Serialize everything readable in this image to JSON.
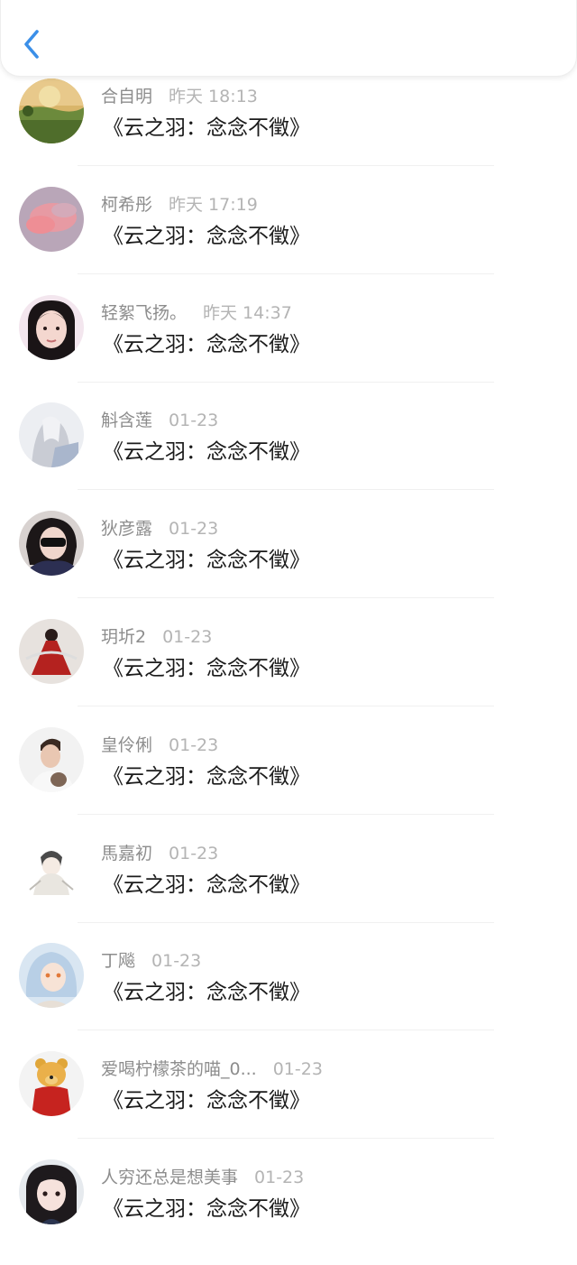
{
  "header": {
    "back_icon": "chevron-left-icon",
    "accent": "#3b8fe8"
  },
  "messages": [
    {
      "name": "合自明",
      "time": "昨天 18:13",
      "text": "《云之羽：念念不徵》",
      "avatar": "landscape-sunset"
    },
    {
      "name": "柯希彤",
      "time": "昨天 17:19",
      "text": "《云之羽：念念不徵》",
      "avatar": "pink-cloud"
    },
    {
      "name": "轻絮飞扬。",
      "time": "昨天 14:37",
      "text": "《云之羽：念念不徵》",
      "avatar": "girl-portrait"
    },
    {
      "name": "斛含莲",
      "time": "01-23",
      "text": "《云之羽：念念不徵》",
      "avatar": "anime-girl-white"
    },
    {
      "name": "狄彦露",
      "time": "01-23",
      "text": "《云之羽：念念不徵》",
      "avatar": "girl-sunglasses"
    },
    {
      "name": "玥圻2",
      "time": "01-23",
      "text": "《云之羽：念念不徵》",
      "avatar": "red-dress-figure"
    },
    {
      "name": "皇伶俐",
      "time": "01-23",
      "text": "《云之羽：念念不徵》",
      "avatar": "man-with-cat"
    },
    {
      "name": "馬嘉初",
      "time": "01-23",
      "text": "《云之羽：念念不徵》",
      "avatar": "chibi-figure"
    },
    {
      "name": "丁飚",
      "time": "01-23",
      "text": "《云之羽：念念不徵》",
      "avatar": "anime-blue-hair"
    },
    {
      "name": "爱喝柠檬茶的喵_0...",
      "time": "01-23",
      "text": "《云之羽：念念不徵》",
      "avatar": "winnie-the-pooh"
    },
    {
      "name": "人穷还总是想美事",
      "time": "01-23",
      "text": "《云之羽：念念不徵》",
      "avatar": "girl-dark-hair"
    }
  ]
}
